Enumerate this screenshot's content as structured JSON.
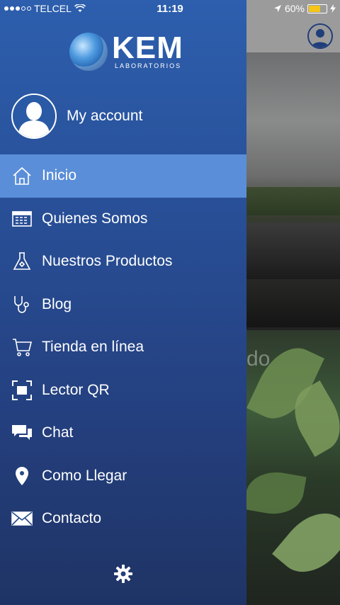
{
  "status_bar": {
    "carrier": "TELCEL",
    "time": "11:19",
    "battery_percent": "60%",
    "signal_bars": 3,
    "signal_total": 5
  },
  "logo": {
    "brand": "KEM",
    "subtitle": "LABORATORIOS"
  },
  "account": {
    "label": "My account"
  },
  "menu": {
    "items": [
      {
        "label": "Inicio",
        "icon": "home-icon",
        "active": true
      },
      {
        "label": "Quienes Somos",
        "icon": "building-icon",
        "active": false
      },
      {
        "label": "Nuestros Productos",
        "icon": "flask-icon",
        "active": false
      },
      {
        "label": "Blog",
        "icon": "stethoscope-icon",
        "active": false
      },
      {
        "label": "Tienda en línea",
        "icon": "cart-icon",
        "active": false
      },
      {
        "label": "Lector QR",
        "icon": "qr-scan-icon",
        "active": false
      },
      {
        "label": "Chat",
        "icon": "chat-icon",
        "active": false
      },
      {
        "label": "Como Llegar",
        "icon": "location-pin-icon",
        "active": false
      },
      {
        "label": "Contacto",
        "icon": "envelope-icon",
        "active": false
      }
    ]
  },
  "background": {
    "overlay_text": "do"
  },
  "colors": {
    "drawer_top": "#2d5fae",
    "drawer_bottom": "#1f3465",
    "active_item": "#5b8ed8",
    "battery": "#f5c518"
  }
}
